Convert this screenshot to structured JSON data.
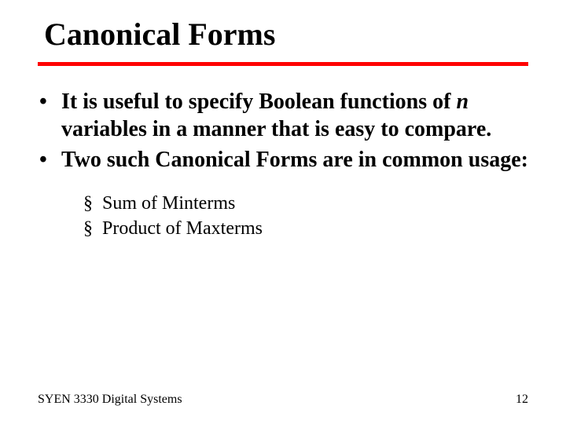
{
  "title": "Canonical Forms",
  "bullets": {
    "b1_pre": "It is useful to specify Boolean functions of ",
    "b1_var": "n",
    "b1_post": " variables in a manner that is easy to compare.",
    "b2": "Two such Canonical Forms are in common usage:"
  },
  "sub": {
    "s1": "Sum of Minterms",
    "s2": "Product of Maxterms"
  },
  "footer": {
    "course": "SYEN 3330 Digital Systems",
    "page": "12"
  },
  "glyphs": {
    "dot": "•",
    "square": "§"
  }
}
